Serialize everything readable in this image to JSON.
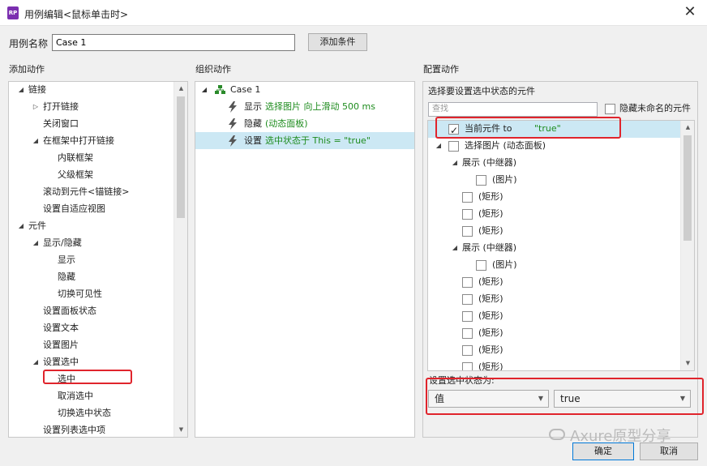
{
  "window": {
    "title": "用例编辑<鼠标单击时>",
    "app_icon": "RP"
  },
  "case": {
    "label": "用例名称",
    "value": "Case 1",
    "add_condition": "添加条件"
  },
  "sections": {
    "add_action": "添加动作",
    "organize_action": "组织动作",
    "configure_action": "配置动作"
  },
  "actions_tree": [
    {
      "label": "链接",
      "level": 0,
      "arrow": "open"
    },
    {
      "label": "打开链接",
      "level": 1,
      "arrow": "closed"
    },
    {
      "label": "关闭窗口",
      "level": 1,
      "arrow": "none"
    },
    {
      "label": "在框架中打开链接",
      "level": 1,
      "arrow": "open"
    },
    {
      "label": "内联框架",
      "level": 2,
      "arrow": "none"
    },
    {
      "label": "父级框架",
      "level": 2,
      "arrow": "none"
    },
    {
      "label": "滚动到元件<锚链接>",
      "level": 1,
      "arrow": "none"
    },
    {
      "label": "设置自适应视图",
      "level": 1,
      "arrow": "none"
    },
    {
      "label": "元件",
      "level": 0,
      "arrow": "open"
    },
    {
      "label": "显示/隐藏",
      "level": 1,
      "arrow": "open"
    },
    {
      "label": "显示",
      "level": 2,
      "arrow": "none"
    },
    {
      "label": "隐藏",
      "level": 2,
      "arrow": "none"
    },
    {
      "label": "切换可见性",
      "level": 2,
      "arrow": "none"
    },
    {
      "label": "设置面板状态",
      "level": 1,
      "arrow": "none"
    },
    {
      "label": "设置文本",
      "level": 1,
      "arrow": "none"
    },
    {
      "label": "设置图片",
      "level": 1,
      "arrow": "none"
    },
    {
      "label": "设置选中",
      "level": 1,
      "arrow": "open"
    },
    {
      "label": "选中",
      "level": 2,
      "arrow": "none"
    },
    {
      "label": "取消选中",
      "level": 2,
      "arrow": "none"
    },
    {
      "label": "切换选中状态",
      "level": 2,
      "arrow": "none"
    },
    {
      "label": "设置列表选中项",
      "level": 1,
      "arrow": "none"
    }
  ],
  "organize": {
    "case_name": "Case 1",
    "actions": [
      {
        "verb": "显示",
        "target": "选择图片 向上滑动 500 ms"
      },
      {
        "verb": "隐藏",
        "target": "(动态面板)"
      },
      {
        "verb": "设置",
        "target": "选中状态于 This = \"true\""
      }
    ]
  },
  "configure": {
    "prompt": "选择要设置选中状态的元件",
    "search_placeholder": "查找",
    "hide_unnamed": "隐藏未命名的元件",
    "tree": [
      {
        "label": "当前元件 to ",
        "value": "\"true\"",
        "level": 0,
        "checked": true,
        "arrow": "none"
      },
      {
        "label": "选择图片 (动态面板)",
        "value": "",
        "level": 0,
        "checked": false,
        "arrow": "open"
      },
      {
        "label": "展示 (中继器)",
        "value": "",
        "level": 1,
        "checked": null,
        "arrow": "open"
      },
      {
        "label": "(图片)",
        "value": "",
        "level": 2,
        "checked": false,
        "arrow": "none"
      },
      {
        "label": "(矩形)",
        "value": "",
        "level": 1,
        "checked": false,
        "arrow": "none"
      },
      {
        "label": "(矩形)",
        "value": "",
        "level": 1,
        "checked": false,
        "arrow": "none"
      },
      {
        "label": "(矩形)",
        "value": "",
        "level": 1,
        "checked": false,
        "arrow": "none"
      },
      {
        "label": "展示 (中继器)",
        "value": "",
        "level": 1,
        "checked": null,
        "arrow": "open"
      },
      {
        "label": "(图片)",
        "value": "",
        "level": 2,
        "checked": false,
        "arrow": "none"
      },
      {
        "label": "(矩形)",
        "value": "",
        "level": 1,
        "checked": false,
        "arrow": "none"
      },
      {
        "label": "(矩形)",
        "value": "",
        "level": 1,
        "checked": false,
        "arrow": "none"
      },
      {
        "label": "(矩形)",
        "value": "",
        "level": 1,
        "checked": false,
        "arrow": "none"
      },
      {
        "label": "(矩形)",
        "value": "",
        "level": 1,
        "checked": false,
        "arrow": "none"
      },
      {
        "label": "(矩形)",
        "value": "",
        "level": 1,
        "checked": false,
        "arrow": "none"
      },
      {
        "label": "(矩形)",
        "value": "",
        "level": 1,
        "checked": false,
        "arrow": "none"
      }
    ],
    "state_label": "设置选中状态为:",
    "mode_select": "值",
    "value_select": "true"
  },
  "buttons": {
    "ok": "确定",
    "cancel": "取消"
  },
  "watermark": "Axure原型分享",
  "colors": {
    "selection": "#cce8f4",
    "highlight_red": "#e0242c",
    "green_text": "#1e8c1e",
    "bolt": "#555555"
  }
}
